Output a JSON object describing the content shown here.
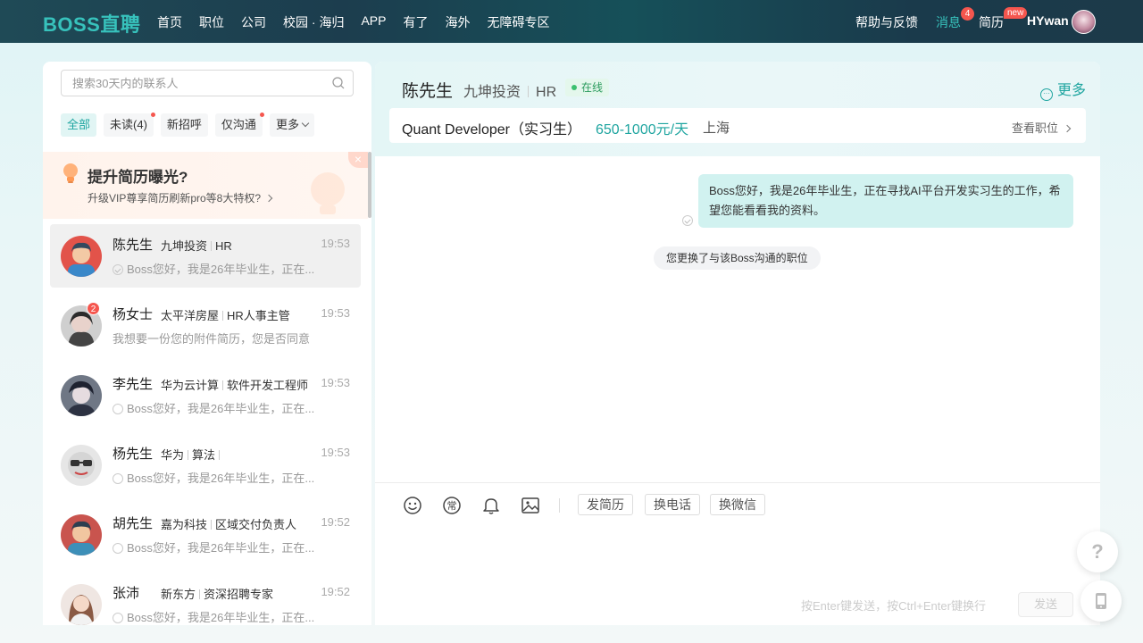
{
  "header": {
    "logo": "BOSS直聘",
    "nav": [
      "首页",
      "职位",
      "公司",
      "校园 · 海归",
      "APP",
      "有了",
      "海外",
      "无障碍专区"
    ],
    "help": "帮助与反馈",
    "messages": "消息",
    "messages_badge": "4",
    "resume": "简历",
    "resume_badge": "new",
    "username": "HYwan"
  },
  "sidebar": {
    "search_placeholder": "搜索30天内的联系人",
    "filters": [
      {
        "label": "全部",
        "active": true,
        "dot": false
      },
      {
        "label": "未读(4)",
        "active": false,
        "dot": true
      },
      {
        "label": "新招呼",
        "active": false,
        "dot": false
      },
      {
        "label": "仅沟通",
        "active": false,
        "dot": true
      },
      {
        "label": "更多",
        "active": false,
        "dot": false
      }
    ],
    "promo": {
      "title": "提升简历曝光?",
      "subtitle": "升级VIP尊享简历刷新pro等8大特权?",
      "close": "×"
    },
    "contacts": [
      {
        "name": "陈先生",
        "company": "九坤投资",
        "role": "HR",
        "time": "19:53",
        "message": "Boss您好，我是26年毕业生，正在...",
        "badge": "",
        "status": "read"
      },
      {
        "name": "杨女士",
        "company": "太平洋房屋",
        "role": "HR人事主管",
        "time": "19:53",
        "message": "我想要一份您的附件简历，您是否同意",
        "badge": "2",
        "status": "none"
      },
      {
        "name": "李先生",
        "company": "华为云计算",
        "role": "软件开发工程师",
        "time": "19:53",
        "message": "Boss您好，我是26年毕业生，正在...",
        "badge": "",
        "status": "sent"
      },
      {
        "name": "杨先生",
        "company": "华为",
        "role": "算法",
        "time": "19:53",
        "message": "Boss您好，我是26年毕业生，正在...",
        "badge": "",
        "status": "sent"
      },
      {
        "name": "胡先生",
        "company": "嘉为科技",
        "role": "区域交付负责人",
        "time": "19:52",
        "message": "Boss您好，我是26年毕业生，正在...",
        "badge": "",
        "status": "sent"
      },
      {
        "name": "张沛",
        "company": "新东方",
        "role": "资深招聘专家",
        "time": "19:52",
        "message": "Boss您好，我是26年毕业生，正在...",
        "badge": "",
        "status": "sent"
      }
    ]
  },
  "chat": {
    "name": "陈先生",
    "company": "九坤投资",
    "role": "HR",
    "online": "在线",
    "more": "更多",
    "job": {
      "title": "Quant Developer（实习生）",
      "salary": "650-1000元/天",
      "city": "上海",
      "view": "查看职位"
    },
    "message": "Boss您好，我是26年毕业生，正在寻找AI平台开发实习生的工作，希望您能看看我的资料。",
    "system_note": "您更换了与该Boss沟通的职位",
    "tools": [
      "发简历",
      "换电话",
      "换微信"
    ],
    "hint": "按Enter键发送，按Ctrl+Enter键换行",
    "send": "发送"
  },
  "floating": {
    "help": "?"
  },
  "colors": {
    "accent": "#1fa5a0",
    "badge": "#f5564e",
    "bubble": "#d1f2f0"
  }
}
